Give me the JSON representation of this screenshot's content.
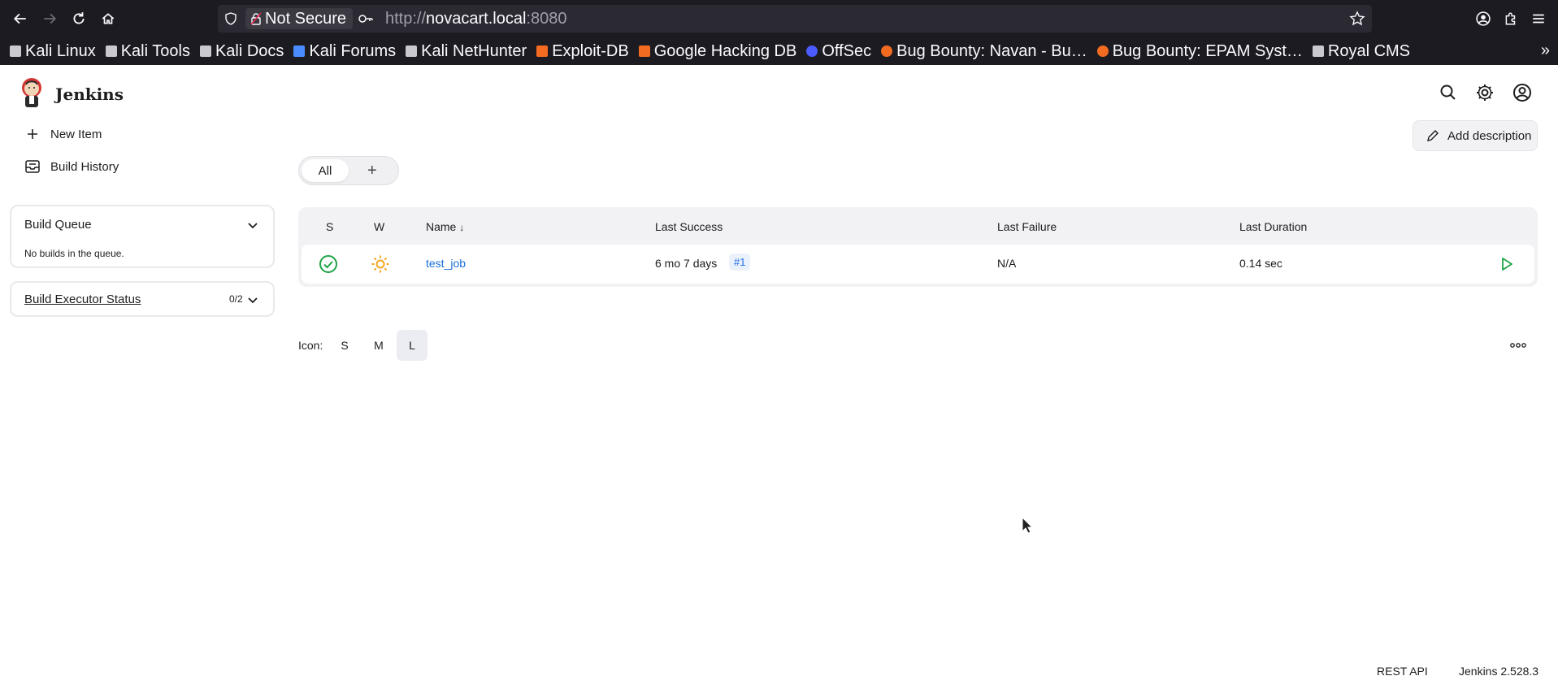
{
  "browser": {
    "url_security": "Not Secure",
    "url_protocol": "http://",
    "url_host": "novacart.local",
    "url_port": ":8080",
    "bookmarks": [
      {
        "label": "Kali Linux",
        "icon": "kali-icon"
      },
      {
        "label": "Kali Tools",
        "icon": "kali-icon"
      },
      {
        "label": "Kali Docs",
        "icon": "kali-icon"
      },
      {
        "label": "Kali Forums",
        "icon": "kali-forums-icon"
      },
      {
        "label": "Kali NetHunter",
        "icon": "kali-icon"
      },
      {
        "label": "Exploit-DB",
        "icon": "exploit-db-icon"
      },
      {
        "label": "Google Hacking DB",
        "icon": "ghdb-icon"
      },
      {
        "label": "OffSec",
        "icon": "offsec-icon"
      },
      {
        "label": "Bug Bounty: Navan - Bu…",
        "icon": "bugcrowd-icon"
      },
      {
        "label": "Bug Bounty: EPAM Syst…",
        "icon": "bugcrowd-icon"
      },
      {
        "label": "Royal CMS",
        "icon": "royal-cms-icon"
      }
    ]
  },
  "jenkins": {
    "title": "Jenkins",
    "sidebar": {
      "new_item": "New Item",
      "build_history": "Build History",
      "build_queue_title": "Build Queue",
      "build_queue_empty": "No builds in the queue.",
      "executor_title": "Build Executor Status",
      "executor_count": "0/2"
    },
    "add_description": "Add description",
    "tabs": {
      "all": "All",
      "add": "+"
    },
    "table": {
      "headers": {
        "s": "S",
        "w": "W",
        "name": "Name",
        "name_sort": "↓",
        "last_success": "Last Success",
        "last_failure": "Last Failure",
        "last_duration": "Last Duration"
      },
      "rows": [
        {
          "name": "test_job",
          "last_success": "6 mo 7 days",
          "build": "#1",
          "last_failure": "N/A",
          "last_duration": "0.14 sec",
          "status": "success",
          "weather": "sunny"
        }
      ]
    },
    "icon_size": {
      "label": "Icon:",
      "options": [
        "S",
        "M",
        "L"
      ],
      "selected": "L"
    },
    "footer": {
      "rest_api": "REST API",
      "version": "Jenkins 2.528.3"
    },
    "colors": {
      "success": "#1ea446",
      "weather": "#f5a623",
      "link": "#1a6dd6",
      "run": "#1ea446"
    }
  }
}
